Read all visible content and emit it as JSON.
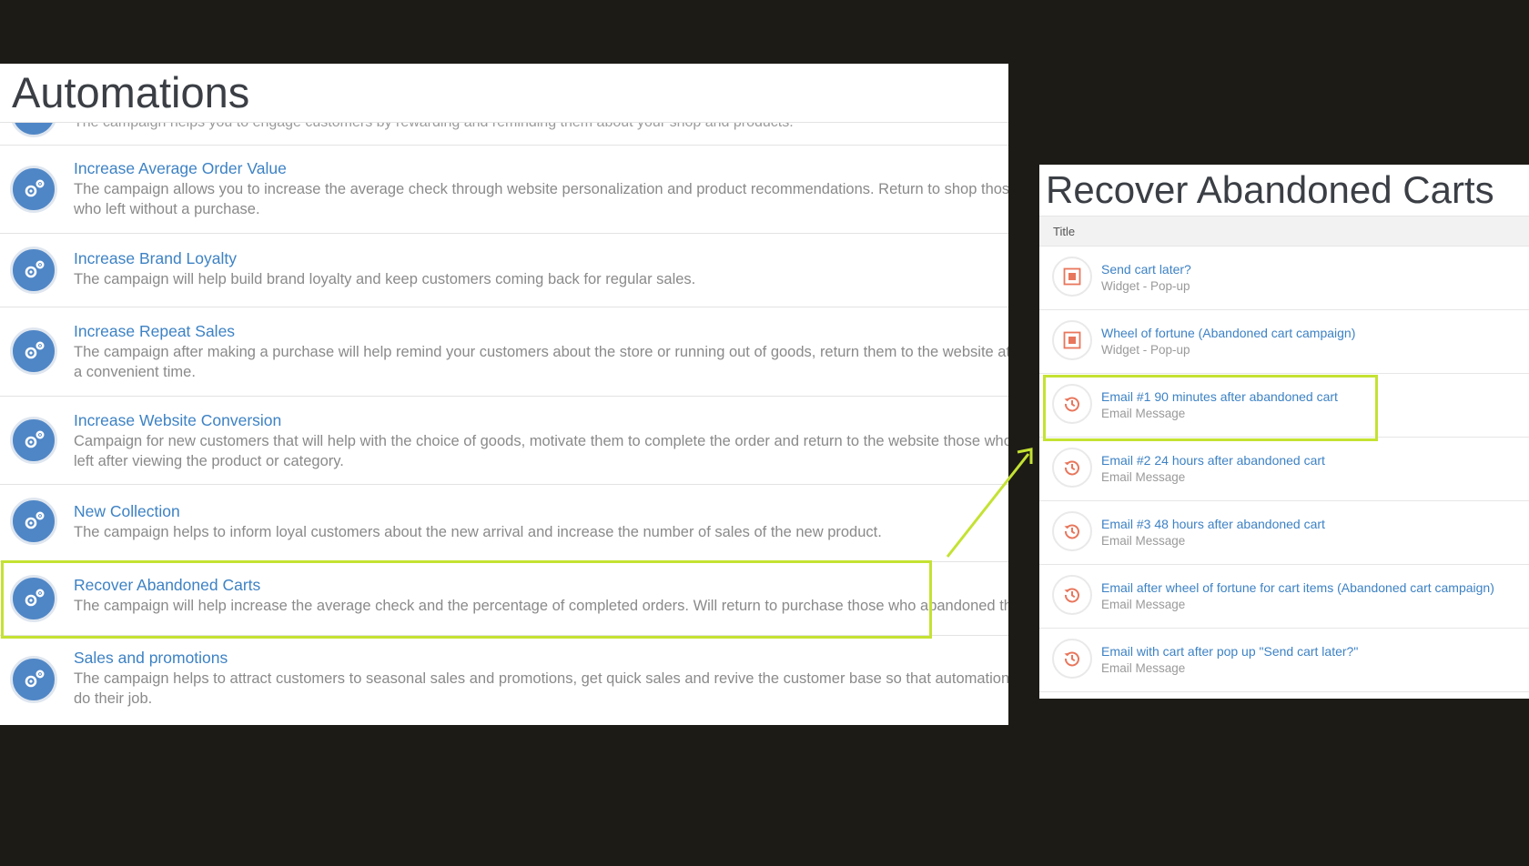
{
  "automations": {
    "title": "Automations",
    "partial_row_text": "The campaign helps you to engage customers by rewarding and reminding them about your shop and products.",
    "items": [
      {
        "name": "Increase Average Order Value",
        "desc": "The campaign allows you to increase the average check through website personalization and product recommendations. Return to shop those who left without a purchase."
      },
      {
        "name": "Increase Brand Loyalty",
        "desc": "The campaign will help build brand loyalty and keep customers coming back for regular sales."
      },
      {
        "name": "Increase Repeat Sales",
        "desc": "The campaign after making a purchase will help remind your customers about the store or running out of goods, return them to the website at a convenient time."
      },
      {
        "name": "Increase Website Conversion",
        "desc": "Campaign for new customers that will help with the choice of goods, motivate them to complete the order and return to the website those who left after viewing the product or category."
      },
      {
        "name": "New Collection",
        "desc": "The campaign helps to inform loyal customers about the new arrival and increase the number of sales of the new product."
      },
      {
        "name": "Recover Abandoned Carts",
        "desc": "The campaign will help increase the average check and the percentage of completed orders. Will return to purchase those who abandoned the cart."
      },
      {
        "name": "Sales and promotions",
        "desc": "The campaign helps to attract customers to seasonal sales and promotions, get quick sales and revive the customer base so that automations do their job."
      }
    ]
  },
  "recover": {
    "title": "Recover Abandoned Carts",
    "column_header": "Title",
    "campaigns": [
      {
        "name": "Send cart later?",
        "type": "Widget - Pop-up",
        "icon": "widget-popup-icon"
      },
      {
        "name": "Wheel of fortune (Abandoned cart campaign)",
        "type": "Widget - Pop-up",
        "icon": "widget-popup-icon"
      },
      {
        "name": "Email #1 90 minutes after abandoned cart",
        "type": "Email Message",
        "icon": "email-history-icon"
      },
      {
        "name": "Email #2 24 hours after abandoned cart",
        "type": "Email Message",
        "icon": "email-history-icon"
      },
      {
        "name": "Email #3 48 hours after abandoned cart",
        "type": "Email Message",
        "icon": "email-history-icon"
      },
      {
        "name": "Email after wheel of fortune for cart items (Abandoned cart campaign)",
        "type": "Email Message",
        "icon": "email-history-icon"
      },
      {
        "name": "Email with cart after pop up \"Send cart later?\"",
        "type": "Email Message",
        "icon": "email-history-icon"
      }
    ]
  },
  "colors": {
    "background": "#1d1b16",
    "link": "#3d82c4",
    "gear_icon_bg": "#4f86c6",
    "highlight": "#c4e232",
    "campaign_icon": "#e8765c"
  }
}
